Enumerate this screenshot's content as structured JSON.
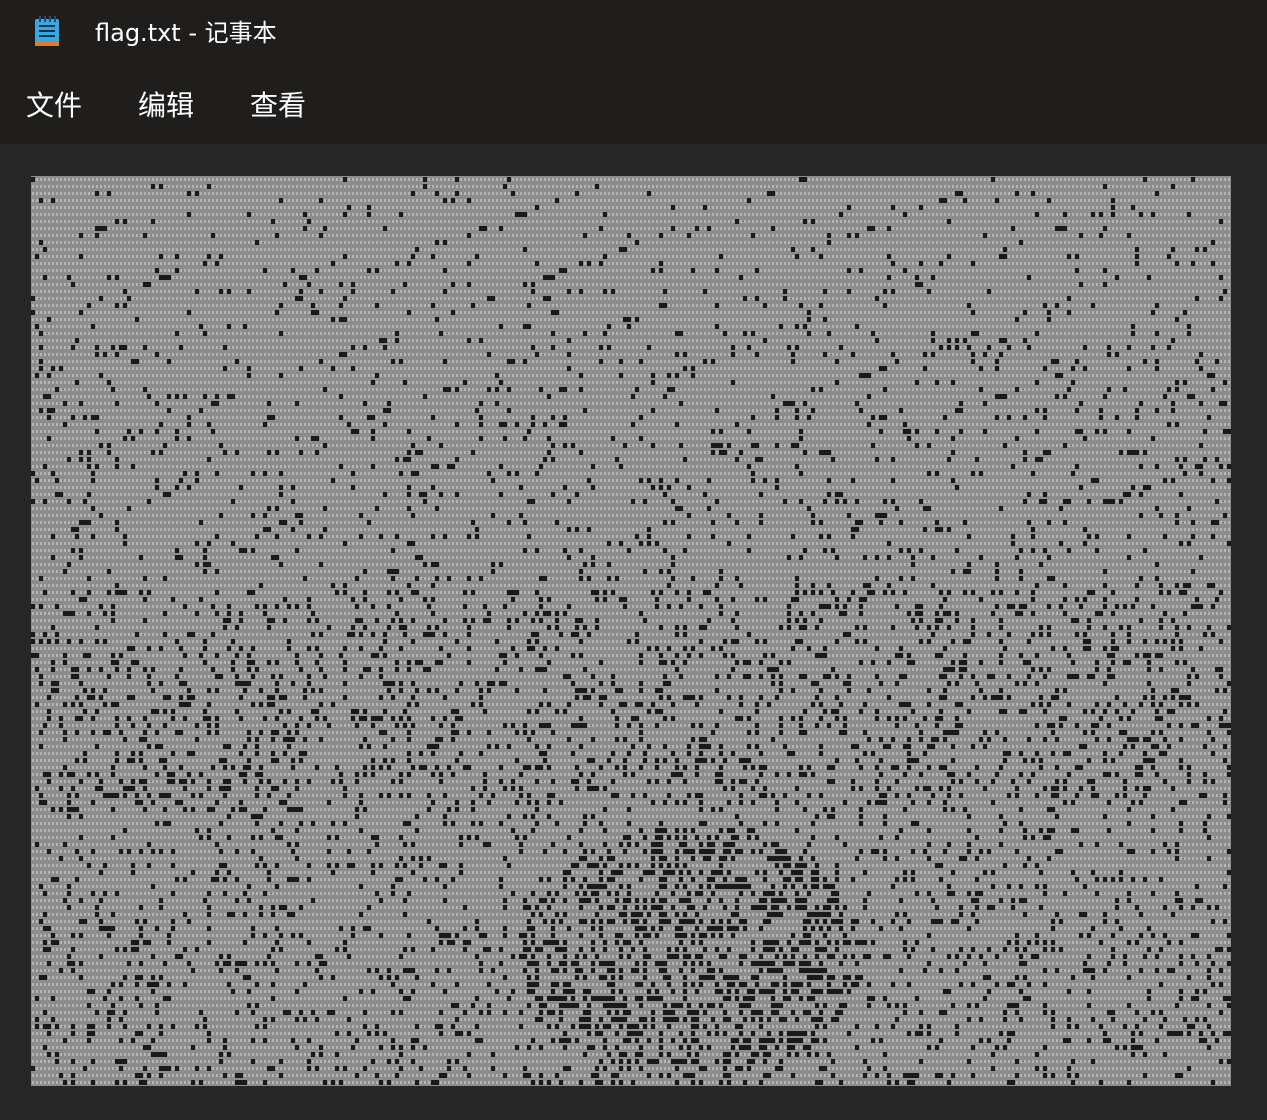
{
  "window": {
    "title": "flag.txt - 记事本",
    "app_icon": "notepad-icon"
  },
  "menu": {
    "items": [
      {
        "label": "文件"
      },
      {
        "label": "编辑"
      },
      {
        "label": "查看"
      }
    ]
  },
  "editor": {
    "content_description": "dense grid of dot characters forming a noisy pattern",
    "colors": {
      "background": "#272727",
      "text_light": "#b4b4b4",
      "text_dark": "#1a1a1a"
    }
  }
}
